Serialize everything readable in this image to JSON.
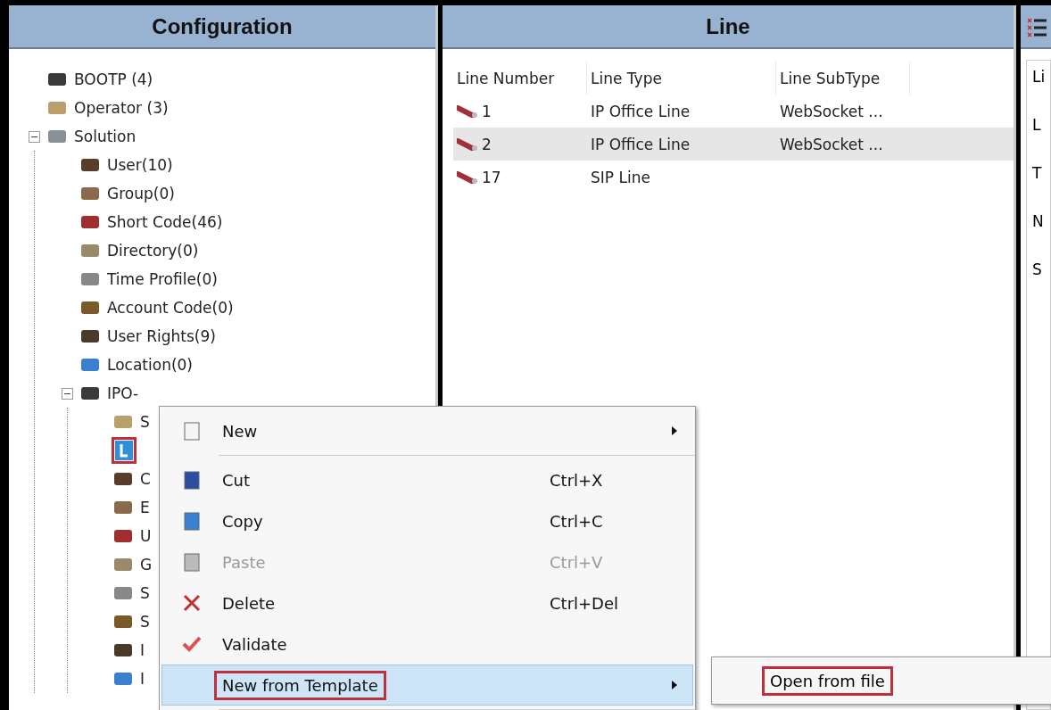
{
  "configuration": {
    "title": "Configuration",
    "tree": [
      {
        "label": "BOOTP (4)"
      },
      {
        "label": "Operator (3)"
      },
      {
        "label": "Solution",
        "expanded": true,
        "children": [
          {
            "label": "User(10)"
          },
          {
            "label": "Group(0)"
          },
          {
            "label": "Short Code(46)"
          },
          {
            "label": "Directory(0)"
          },
          {
            "label": "Time Profile(0)"
          },
          {
            "label": "Account Code(0)"
          },
          {
            "label": "User Rights(9)"
          },
          {
            "label": "Location(0)"
          },
          {
            "label": "IPO-",
            "expanded": true,
            "children": [
              {
                "label": "S"
              },
              {
                "annotated": true
              },
              {
                "label": "C"
              },
              {
                "label": "E"
              },
              {
                "label": "U"
              },
              {
                "label": "G"
              },
              {
                "label": "S"
              },
              {
                "label": "S"
              },
              {
                "label": "I"
              },
              {
                "label": "I"
              }
            ]
          }
        ]
      }
    ]
  },
  "line": {
    "title": "Line",
    "columns": [
      "Line Number",
      "Line Type",
      "Line SubType"
    ],
    "rows": [
      {
        "cells": [
          "1",
          "IP Office Line",
          "WebSocket ..."
        ],
        "selected": false
      },
      {
        "cells": [
          "2",
          "IP Office Line",
          "WebSocket ..."
        ],
        "selected": true
      },
      {
        "cells": [
          "17",
          "SIP Line",
          ""
        ],
        "selected": false
      }
    ]
  },
  "detail": {
    "labels": [
      "Li",
      "L",
      "T",
      "N",
      "S"
    ]
  },
  "context_menu": {
    "items": [
      {
        "kind": "item",
        "label": "New",
        "submenu": true,
        "disabled": false,
        "selected": false,
        "annotated": false
      },
      {
        "kind": "separator"
      },
      {
        "kind": "item",
        "label": "Cut",
        "shortcut": "Ctrl+X",
        "disabled": false,
        "selected": false,
        "annotated": false
      },
      {
        "kind": "item",
        "label": "Copy",
        "shortcut": "Ctrl+C",
        "disabled": false,
        "selected": false,
        "annotated": false
      },
      {
        "kind": "item",
        "label": "Paste",
        "shortcut": "Ctrl+V",
        "disabled": true,
        "selected": false,
        "annotated": false
      },
      {
        "kind": "item",
        "label": "Delete",
        "shortcut": "Ctrl+Del",
        "disabled": false,
        "selected": false,
        "annotated": false
      },
      {
        "kind": "item",
        "label": "Validate",
        "disabled": false,
        "selected": false,
        "annotated": false
      },
      {
        "kind": "item",
        "label": "New from Template",
        "submenu": true,
        "disabled": false,
        "selected": true,
        "annotated": true
      },
      {
        "kind": "separator"
      }
    ]
  },
  "submenu": {
    "items": [
      {
        "label": "Open from file",
        "annotated": true
      }
    ]
  }
}
